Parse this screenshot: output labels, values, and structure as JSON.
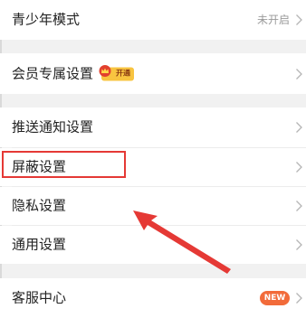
{
  "settings": {
    "items": [
      {
        "label": "青少年模式",
        "value": "未开启"
      },
      {
        "label": "会员专属设置",
        "badge": "开通"
      },
      {
        "label": "推送通知设置"
      },
      {
        "label": "屏蔽设置"
      },
      {
        "label": "隐私设置"
      },
      {
        "label": "通用设置"
      },
      {
        "label": "客服中心",
        "badge": "NEW"
      }
    ]
  },
  "colors": {
    "background": "#f1f1f1",
    "row": "#ffffff",
    "highlight": "#e53935",
    "new_badge": "#f26b3a",
    "member_badge": "#f8c440"
  }
}
